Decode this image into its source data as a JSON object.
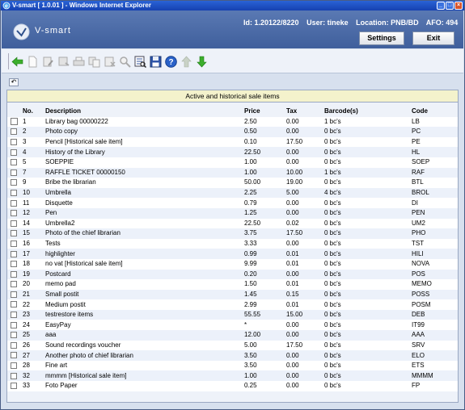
{
  "window": {
    "title": "V-smart [ 1.0.01 ] - Windows Internet Explorer",
    "minimize": "_",
    "maximize": "□",
    "close": "×"
  },
  "header": {
    "logo_text": "V-smart",
    "id_text": "Id: 1.20122/8220",
    "user_text": "User: tineke",
    "location_text": "Location: PNB/BD",
    "afo_text": "AFO: 494",
    "settings_label": "Settings",
    "exit_label": "Exit"
  },
  "toolbar": {
    "icons": [
      "back-arrow-icon",
      "new-document-icon",
      "edit-icon",
      "save-icon",
      "print-icon",
      "copy-icon",
      "delete-icon",
      "search-icon",
      "view-icon",
      "save-disk-icon",
      "help-icon",
      "move-up-icon",
      "move-down-icon"
    ]
  },
  "subbar": {
    "undo_glyph": "↶"
  },
  "panel": {
    "title": "Active and historical sale items",
    "columns": [
      "No.",
      "Description",
      "Price",
      "Tax",
      "Barcode(s)",
      "Code"
    ],
    "rows": [
      {
        "no": "1",
        "desc": "Library bag 00000222",
        "price": "2.50",
        "tax": "0.00",
        "barcodes": "1 bc's",
        "code": "LB"
      },
      {
        "no": "2",
        "desc": "Photo copy",
        "price": "0.50",
        "tax": "0.00",
        "barcodes": "0 bc's",
        "code": "PC"
      },
      {
        "no": "3",
        "desc": "Pencil [Historical sale item]",
        "price": "0.10",
        "tax": "17.50",
        "barcodes": "0 bc's",
        "code": "PE"
      },
      {
        "no": "4",
        "desc": "History of the Library",
        "price": "22.50",
        "tax": "0.00",
        "barcodes": "0 bc's",
        "code": "HL"
      },
      {
        "no": "5",
        "desc": "SOEPPIE",
        "price": "1.00",
        "tax": "0.00",
        "barcodes": "0 bc's",
        "code": "SOEP"
      },
      {
        "no": "7",
        "desc": "RAFFLE TICKET 00000150",
        "price": "1.00",
        "tax": "10.00",
        "barcodes": "1 bc's",
        "code": "RAF"
      },
      {
        "no": "9",
        "desc": "Bribe the librarian",
        "price": "50.00",
        "tax": "19.00",
        "barcodes": "0 bc's",
        "code": "BTL"
      },
      {
        "no": "10",
        "desc": "Umbrella",
        "price": "2.25",
        "tax": "5.00",
        "barcodes": "4 bc's",
        "code": "BROL"
      },
      {
        "no": "11",
        "desc": "Disquette",
        "price": "0.79",
        "tax": "0.00",
        "barcodes": "0 bc's",
        "code": "DI"
      },
      {
        "no": "12",
        "desc": "Pen",
        "price": "1.25",
        "tax": "0.00",
        "barcodes": "0 bc's",
        "code": "PEN"
      },
      {
        "no": "14",
        "desc": "Umbrella2",
        "price": "22.50",
        "tax": "0.02",
        "barcodes": "0 bc's",
        "code": "UM2"
      },
      {
        "no": "15",
        "desc": "Photo of the chief librarian",
        "price": "3.75",
        "tax": "17.50",
        "barcodes": "0 bc's",
        "code": "PHO"
      },
      {
        "no": "16",
        "desc": "Tests",
        "price": "3.33",
        "tax": "0.00",
        "barcodes": "0 bc's",
        "code": "TST"
      },
      {
        "no": "17",
        "desc": "highlighter",
        "price": "0.99",
        "tax": "0.01",
        "barcodes": "0 bc's",
        "code": "HILI"
      },
      {
        "no": "18",
        "desc": "no vat [Historical sale item]",
        "price": "9.99",
        "tax": "0.01",
        "barcodes": "0 bc's",
        "code": "NOVA"
      },
      {
        "no": "19",
        "desc": "Postcard",
        "price": "0.20",
        "tax": "0.00",
        "barcodes": "0 bc's",
        "code": "POS"
      },
      {
        "no": "20",
        "desc": "memo pad",
        "price": "1.50",
        "tax": "0.01",
        "barcodes": "0 bc's",
        "code": "MEMO"
      },
      {
        "no": "21",
        "desc": "Small postit",
        "price": "1.45",
        "tax": "0.15",
        "barcodes": "0 bc's",
        "code": "POSS"
      },
      {
        "no": "22",
        "desc": "Medium postit",
        "price": "2.99",
        "tax": "0.01",
        "barcodes": "0 bc's",
        "code": "POSM"
      },
      {
        "no": "23",
        "desc": "testrestore items",
        "price": "55.55",
        "tax": "15.00",
        "barcodes": "0 bc's",
        "code": "DEB"
      },
      {
        "no": "24",
        "desc": "EasyPay",
        "price": "*",
        "tax": "0.00",
        "barcodes": "0 bc's",
        "code": "IT99"
      },
      {
        "no": "25",
        "desc": "aaa",
        "price": "12.00",
        "tax": "0.00",
        "barcodes": "0 bc's",
        "code": "AAA"
      },
      {
        "no": "26",
        "desc": "Sound recordings voucher",
        "price": "5.00",
        "tax": "17.50",
        "barcodes": "0 bc's",
        "code": "SRV"
      },
      {
        "no": "27",
        "desc": "Another photo of chief librarian",
        "price": "3.50",
        "tax": "0.00",
        "barcodes": "0 bc's",
        "code": "ELO"
      },
      {
        "no": "28",
        "desc": "Fine art",
        "price": "3.50",
        "tax": "0.00",
        "barcodes": "0 bc's",
        "code": "ETS"
      },
      {
        "no": "32",
        "desc": "mmmm [Historical sale item]",
        "price": "1.00",
        "tax": "0.00",
        "barcodes": "0 bc's",
        "code": "MMMM"
      },
      {
        "no": "33",
        "desc": "Foto Paper",
        "price": "0.25",
        "tax": "0.00",
        "barcodes": "0 bc's",
        "code": "FP"
      }
    ]
  }
}
